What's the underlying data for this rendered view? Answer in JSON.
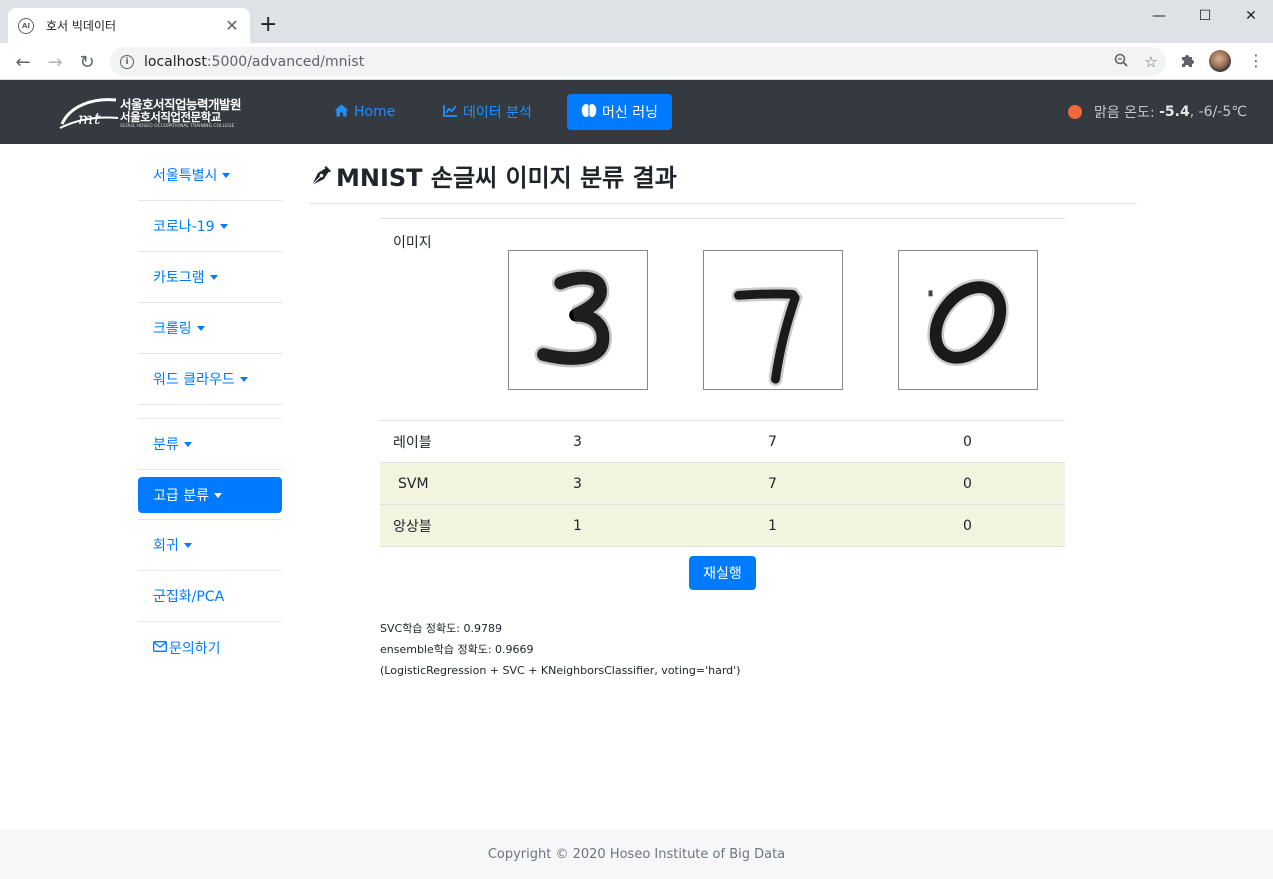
{
  "browser": {
    "tab_title": "호서 빅데이터",
    "url_host": "localhost",
    "url_path": ":5000/advanced/mnist",
    "favicon_text": "AI"
  },
  "navbar": {
    "logo": {
      "line1": "서울호서직업능력개발원",
      "line2": "서울호서직업전문학교",
      "line3": "SEOUL HOSEO OCCUPATIONAL TRAINING COLLEGE"
    },
    "links": [
      {
        "label": "Home",
        "icon": "home-icon"
      },
      {
        "label": "데이터 분석",
        "icon": "chart-icon"
      },
      {
        "label": "머신 러닝",
        "icon": "brain-icon",
        "active": true
      }
    ],
    "weather": {
      "label": "맑음 온도:",
      "temp": "-5.4",
      "range": ", -6/-5℃",
      "dot_color": "#f06a3b"
    }
  },
  "sidebar": {
    "items": [
      {
        "label": "서울특별시",
        "dropdown": true
      },
      {
        "label": "코로나-19",
        "dropdown": true
      },
      {
        "label": "카토그램",
        "dropdown": true
      },
      {
        "label": "크롤링",
        "dropdown": true
      },
      {
        "label": "워드 클라우드",
        "dropdown": true
      },
      {
        "label": "분류",
        "dropdown": true
      },
      {
        "label": "고급 분류",
        "dropdown": true,
        "active": true
      },
      {
        "label": "회귀",
        "dropdown": true
      },
      {
        "label": "군집화/PCA",
        "dropdown": false
      },
      {
        "label": "문의하기",
        "dropdown": false,
        "icon": "envelope-icon"
      }
    ]
  },
  "main": {
    "title": "MNIST 손글씨 이미지 분류 결과",
    "title_icon": "pen-nib-icon",
    "table": {
      "image_header": "이미지",
      "digits": [
        "3",
        "7",
        "0"
      ],
      "rows": [
        {
          "header": "레이블",
          "values": [
            "3",
            "7",
            "0"
          ],
          "highlight": false
        },
        {
          "header": "SVM",
          "values": [
            "3",
            "7",
            "0"
          ],
          "highlight": true
        },
        {
          "header": "앙상블",
          "values": [
            "1",
            "1",
            "0"
          ],
          "highlight": true
        }
      ]
    },
    "rerun_label": "재실행",
    "notes": {
      "svc": "SVC학습 정확도: 0.9789",
      "ensemble": "ensemble학습 정확도: 0.9669",
      "detail": "(LogisticRegression + SVC + KNeighborsClassifier, voting='hard')"
    }
  },
  "footer": {
    "text": "Copyright © 2020 Hoseo Institute of Big Data"
  },
  "colors": {
    "primary": "#007bff",
    "navbar_bg": "#343a40",
    "highlight_row": "#f3f4df"
  }
}
